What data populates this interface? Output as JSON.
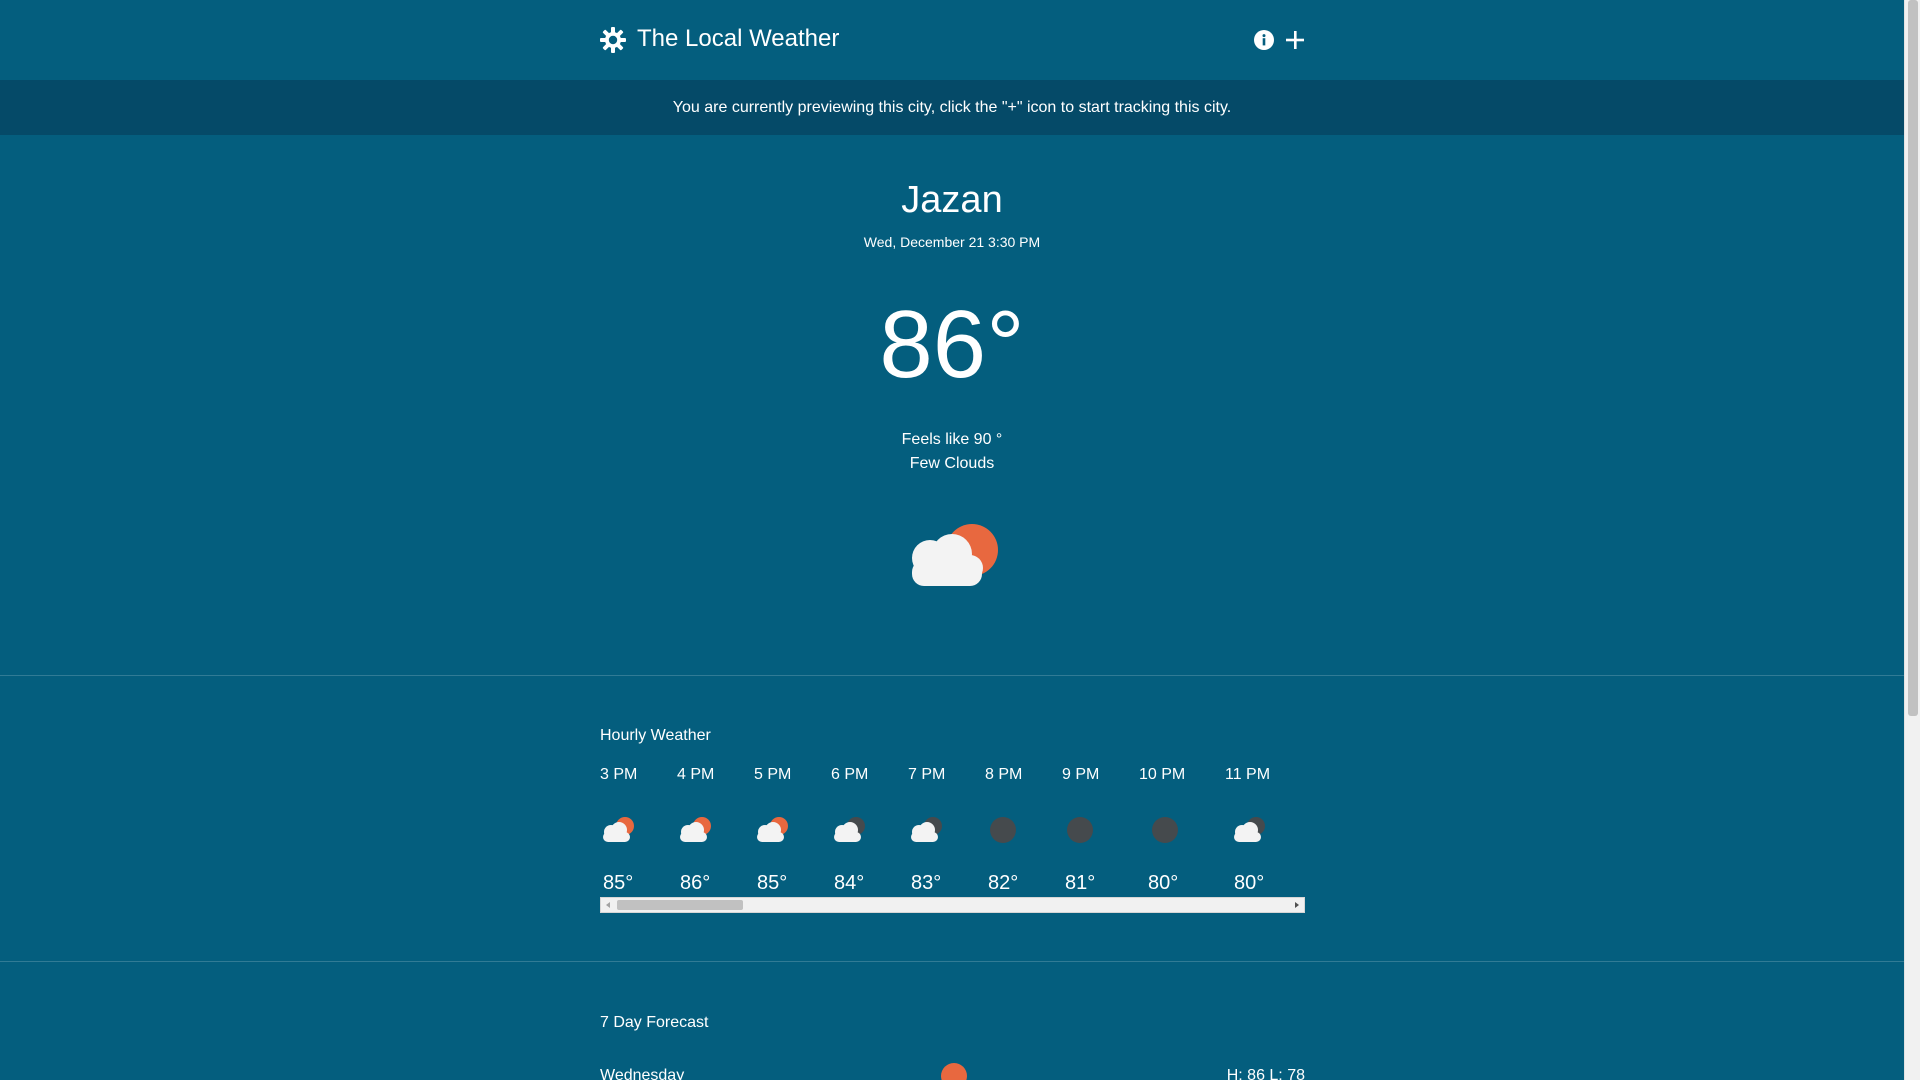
{
  "header": {
    "title": "The Local Weather",
    "logo_icon": "gear-sun-icon",
    "info_icon": "info-icon",
    "add_icon": "plus-icon"
  },
  "banner": {
    "text": "You are currently previewing this city, click the \"+\" icon to start tracking this city."
  },
  "current": {
    "city": "Jazan",
    "datetime": "Wed, December 21 3:30 PM",
    "temperature": "86°",
    "feels_like": "Feels like 90 °",
    "condition": "Few Clouds",
    "icon": "few-clouds-day-icon"
  },
  "hourly": {
    "title": "Hourly Weather",
    "items": [
      {
        "time": "3 PM",
        "temp": "85°",
        "icon": "few-clouds-day-icon"
      },
      {
        "time": "4 PM",
        "temp": "86°",
        "icon": "few-clouds-day-icon"
      },
      {
        "time": "5 PM",
        "temp": "85°",
        "icon": "few-clouds-day-icon"
      },
      {
        "time": "6 PM",
        "temp": "84°",
        "icon": "few-clouds-night-icon"
      },
      {
        "time": "7 PM",
        "temp": "83°",
        "icon": "few-clouds-night-icon"
      },
      {
        "time": "8 PM",
        "temp": "82°",
        "icon": "clear-night-icon"
      },
      {
        "time": "9 PM",
        "temp": "81°",
        "icon": "clear-night-icon"
      },
      {
        "time": "10 PM",
        "temp": "80°",
        "icon": "clear-night-icon"
      },
      {
        "time": "11 PM",
        "temp": "80°",
        "icon": "few-clouds-night-icon"
      }
    ]
  },
  "forecast": {
    "title": "7 Day Forecast",
    "days": [
      {
        "day": "Wednesday",
        "hilo": "H: 86 L: 78",
        "icon": "sun-icon"
      }
    ]
  },
  "colors": {
    "background": "#045e7e",
    "banner": "#054a68",
    "sun": "#e8683f",
    "moon": "#454a4d",
    "cloud": "#f3f3f3"
  }
}
